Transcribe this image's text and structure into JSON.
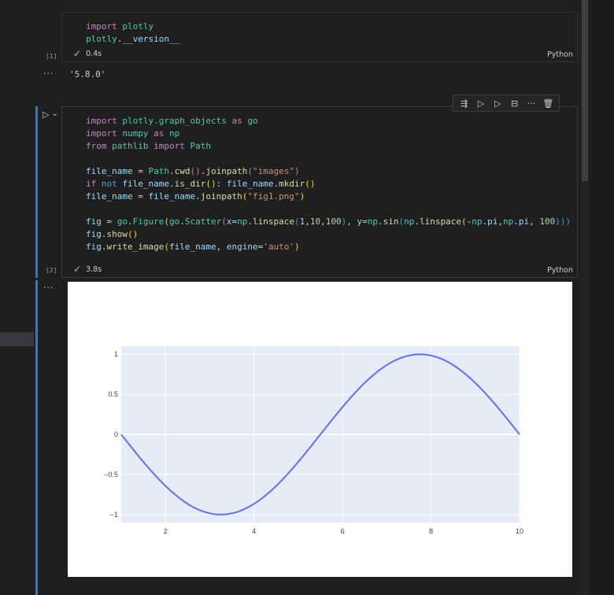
{
  "cells": [
    {
      "exec_count": "[1]",
      "duration": "0.4s",
      "language": "Python",
      "output": "'5.8.0'"
    },
    {
      "exec_count": "[2]",
      "duration": "3.8s",
      "language": "Python"
    }
  ],
  "code": {
    "c1": {
      "l1_kw": "import",
      "l1_mod": "plotly",
      "l2_obj": "plotly",
      "l2_dot": ".",
      "l2_attr": "__version__"
    },
    "c2": {
      "l1_kw": "import",
      "l1_mod": "plotly.graph_objects",
      "l1_as": "as",
      "l1_alias": "go",
      "l2_kw": "import",
      "l2_mod": "numpy",
      "l2_as": "as",
      "l2_alias": "np",
      "l3_from": "from",
      "l3_mod": "pathlib",
      "l3_import": "import",
      "l3_cls": "Path",
      "l5": "file_name",
      "l5_eq": " = ",
      "l5_cls": "Path",
      "l5_rest1": ".",
      "l5_fn1": "cwd",
      "l5_p1": "()",
      "l5_rest2": ".",
      "l5_fn2": "joinpath",
      "l5_p2o": "(",
      "l5_str": "\"images\"",
      "l5_p2c": ")",
      "l6_if": "if",
      "l6_not": " not ",
      "l6_var": "file_name",
      "l6_dot": ".",
      "l6_fn": "is_dir",
      "l6_p": "()",
      "l6_colon": ": ",
      "l6_var2": "file_name",
      "l6_dot2": ".",
      "l6_fn2": "mkdir",
      "l6_p2": "()",
      "l7": "file_name",
      "l7_eq": " = ",
      "l7_var": "file_name",
      "l7_dot": ".",
      "l7_fn": "joinpath",
      "l7_po": "(",
      "l7_str": "\"fig1.png\"",
      "l7_pc": ")",
      "l9_fig": "fig",
      "l9_eq": " = ",
      "l9_go": "go",
      "l9_dot": ".",
      "l9_fn": "Figure",
      "l9_p1": "(",
      "l9_go2": "go",
      "l9_dot2": ".",
      "l9_fn2": "Scatter",
      "l9_p2": "(",
      "l9_x": "x",
      "l9_eq2": "=",
      "l9_np": "np",
      "l9_dot3": ".",
      "l9_fn3": "linspace",
      "l9_p3": "(",
      "l9_n1": "1",
      "l9_c1": ",",
      "l9_n2": "10",
      "l9_c2": ",",
      "l9_n3": "100",
      "l9_p3c": ")",
      "l9_c3": ", ",
      "l9_y": "y",
      "l9_eq3": "=",
      "l9_np2": "np",
      "l9_dot4": ".",
      "l9_fn4": "sin",
      "l9_p4": "(",
      "l9_np3": "np",
      "l9_dot5": ".",
      "l9_fn5": "linspace",
      "l9_p5": "(",
      "l9_neg": "-",
      "l9_np4": "np",
      "l9_dot6": ".",
      "l9_pi1": "pi",
      "l9_c4": ",",
      "l9_np5": "np",
      "l9_dot7": ".",
      "l9_pi2": "pi",
      "l9_c5": ", ",
      "l9_n4": "100",
      "l9_end": ")))",
      "l10_fig": "fig",
      "l10_dot": ".",
      "l10_fn": "show",
      "l10_p": "()",
      "l11_fig": "fig",
      "l11_dot": ".",
      "l11_fn": "write_image",
      "l11_po": "(",
      "l11_var": "file_name",
      "l11_c": ", ",
      "l11_kw": "engine",
      "l11_eq": "=",
      "l11_str": "'auto'",
      "l11_pc": ")"
    }
  },
  "toolbar_icons": [
    "run-by-line-icon",
    "execute-above-icon",
    "execute-below-icon",
    "split-cell-icon",
    "more-icon",
    "delete-icon"
  ],
  "toolbar_glyphs": [
    "⇶",
    "▷",
    "▷",
    "⊟",
    "···",
    "🗑"
  ],
  "out_dots": "···",
  "run_glyph": "▷",
  "run_chevron": "⌄",
  "check_glyph": "✓",
  "colors": {
    "accent_bar": "#2c7ad6",
    "plot_bg": "#e5ecf6",
    "line": "#636efa",
    "check": "#89d185"
  },
  "chart_data": {
    "type": "line",
    "x_formula": "linspace(1, 10, 100)",
    "y_formula": "sin(linspace(-pi, pi, 100))",
    "n_points": 100,
    "xlim": [
      1,
      10
    ],
    "ylim": [
      -1.1,
      1.1
    ],
    "x_ticks": [
      2,
      4,
      6,
      8,
      10
    ],
    "x_tick_labels": [
      "2",
      "4",
      "6",
      "8",
      "10"
    ],
    "y_ticks": [
      1,
      0.5,
      0,
      -0.5,
      -1
    ],
    "y_tick_labels": [
      "1",
      "0.5",
      "0",
      "−0.5",
      "−1"
    ],
    "grid": true,
    "title": "",
    "xlabel": "",
    "ylabel": ""
  }
}
